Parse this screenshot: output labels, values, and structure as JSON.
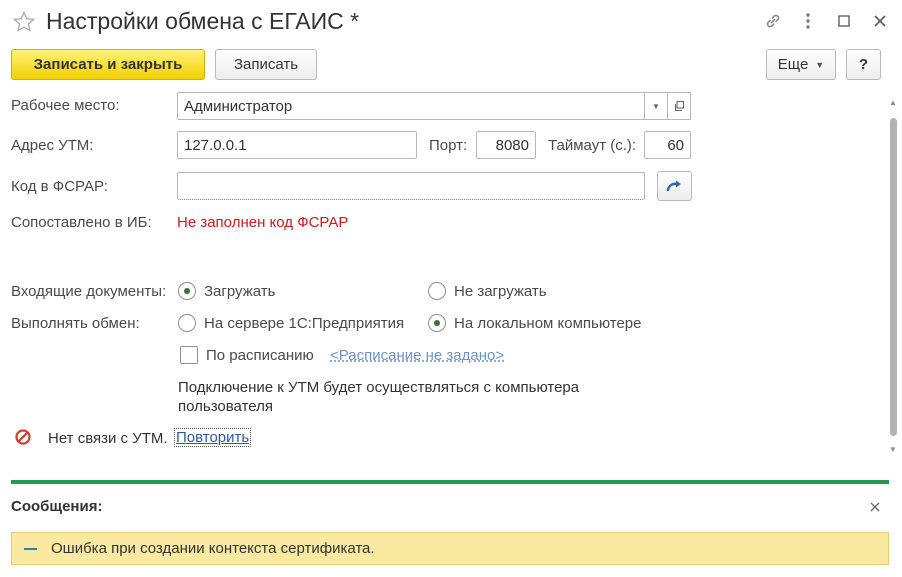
{
  "window": {
    "title": "Настройки обмена с ЕГАИС *",
    "icons": [
      "star-icon",
      "link-icon",
      "more-vertical-icon",
      "maximize-icon",
      "close-icon"
    ]
  },
  "toolbar": {
    "save_close_label": "Записать и закрыть",
    "save_label": "Записать",
    "more_label": "Еще",
    "help_label": "?"
  },
  "form": {
    "workplace_label": "Рабочее место:",
    "workplace_value": "Администратор",
    "utm_address_label": "Адрес УТМ:",
    "utm_address_value": "127.0.0.1",
    "port_label": "Порт:",
    "port_value": "8080",
    "timeout_label": "Таймаут (с.):",
    "timeout_value": "60",
    "fsrar_label": "Код в ФСРАР:",
    "fsrar_value": "",
    "matched_label": "Сопоставлено в ИБ:",
    "matched_value": "Не заполнен код ФСРАР",
    "incoming_label": "Входящие документы:",
    "incoming_options": [
      {
        "label": "Загружать",
        "selected": true
      },
      {
        "label": "Не загружать",
        "selected": false
      }
    ],
    "exchange_label": "Выполнять обмен:",
    "exchange_options": [
      {
        "label": "На сервере 1С:Предприятия",
        "selected": false
      },
      {
        "label": "На локальном компьютере",
        "selected": true
      }
    ],
    "schedule_checkbox_label": "По расписанию",
    "schedule_checked": false,
    "schedule_link": "<Расписание не задано>",
    "connection_note_line1": "Подключение к УТМ будет осуществляться с компьютера",
    "connection_note_line2": "пользователя",
    "status_text": "Нет связи с УТМ.",
    "retry_link": "Повторить"
  },
  "messages": {
    "title": "Сообщения:",
    "items": [
      "Ошибка при создании контекста сертификата."
    ]
  },
  "colors": {
    "primary_button": "#f2d100",
    "error_text": "#cc1c1c",
    "separator": "#1f9b4e",
    "message_bg": "#fae9a1",
    "radio_dot": "#3b6e3b"
  }
}
